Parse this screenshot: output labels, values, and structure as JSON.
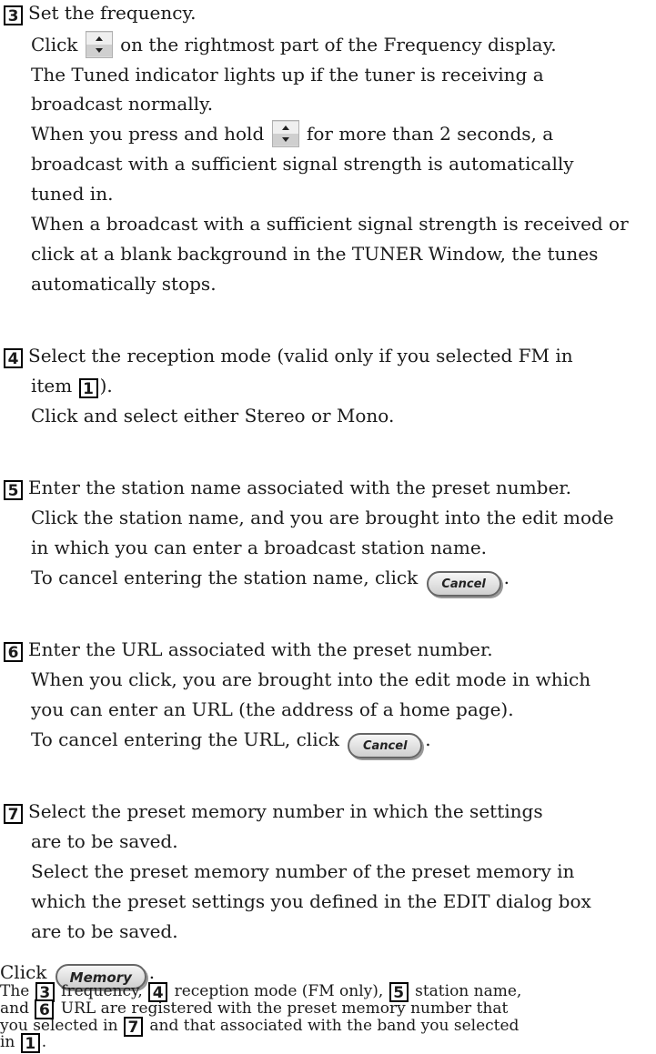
{
  "steps": [
    {
      "number": "3",
      "title": "Set the frequency.",
      "p1a": "Click",
      "p1b": "on the rightmost part of the Frequency display.",
      "p2": "The Tuned indicator lights up if the tuner is receiving a",
      "p3": "broadcast normally.",
      "p4a": "When you press and hold",
      "p4b": "for more than 2 seconds, a",
      "p5": "broadcast with a sufficient signal strength is automatically",
      "p6": "tuned in.",
      "p7": "When a broadcast with a sufficient signal strength is received or",
      "p8": "click at a blank background in the TUNER Window, the tunes",
      "p9": "automatically stops."
    },
    {
      "number": "4",
      "title": "Select the reception mode (valid only if you selected FM in",
      "t2a": "item",
      "t2ref": "1",
      "t2b": ").",
      "p1": "Click and select either Stereo or Mono."
    },
    {
      "number": "5",
      "title": "Enter the station name associated with the preset number.",
      "p1": "Click the station name, and you are brought into the edit mode",
      "p2": "in which you can enter a broadcast station name.",
      "p3": "To cancel entering the station name, click",
      "p3end": "."
    },
    {
      "number": "6",
      "title": "Enter the URL associated with the preset number.",
      "p1": "When you click, you are brought into the edit mode in which",
      "p2": "you can enter an URL (the address of a home page).",
      "p3": "To cancel entering the URL, click",
      "p3end": "."
    },
    {
      "number": "7",
      "title": "Select the preset memory number in which the settings",
      "t2": "are to be saved.",
      "p1": "Select the preset memory number of the preset memory in",
      "p2": "which the preset settings you defined in the EDIT dialog box",
      "p3": "are to be saved."
    }
  ],
  "buttons": {
    "cancel": "Cancel",
    "memory": "Memory"
  },
  "final": {
    "click": "Click",
    "click_end": ".",
    "l2_a": "The",
    "ref3": "3",
    "l2_b": "frequency,",
    "ref4": "4",
    "l2_c": "reception mode (FM only),",
    "ref5": "5",
    "l2_d": "station name,",
    "l3_a": "and",
    "ref6": "6",
    "l3_b": "URL are registered with the preset memory number that",
    "l4_a": "you selected in",
    "ref7": "7",
    "l4_b": "and that associated with the band you selected",
    "l5_a": "in",
    "ref1": "1",
    "l5_b": "."
  },
  "icons": {
    "spin": "up-down-spin-icon"
  }
}
